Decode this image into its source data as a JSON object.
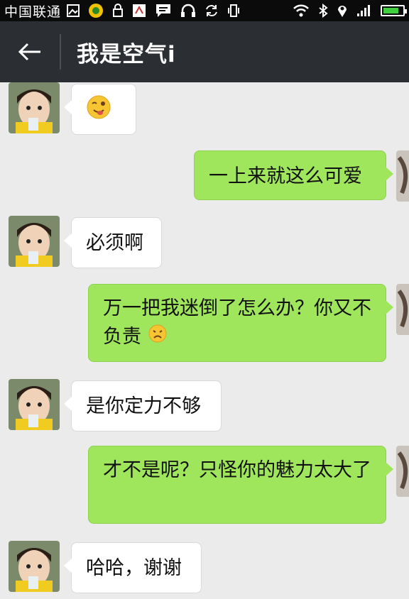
{
  "status_bar": {
    "carrier": "中国联通"
  },
  "header": {
    "title": "我是空气i"
  },
  "messages": [
    {
      "side": "in",
      "text": "",
      "emoji": "winking-tongue-emoji"
    },
    {
      "side": "out",
      "text": "一上来就这么可爱"
    },
    {
      "side": "in",
      "text": "必须啊"
    },
    {
      "side": "out",
      "text": "万一把我迷倒了怎么办？你又不负责",
      "emoji": "sad-face-emoji"
    },
    {
      "side": "in",
      "text": "是你定力不够"
    },
    {
      "side": "out",
      "text": "才不是呢？只怪你的魅力太大了"
    },
    {
      "side": "in",
      "text": "哈哈，谢谢"
    }
  ],
  "colors": {
    "outgoing_bubble": "#9fe65c",
    "incoming_bubble": "#ffffff",
    "title_bar": "#2b2f33",
    "background": "#ebebeb"
  }
}
